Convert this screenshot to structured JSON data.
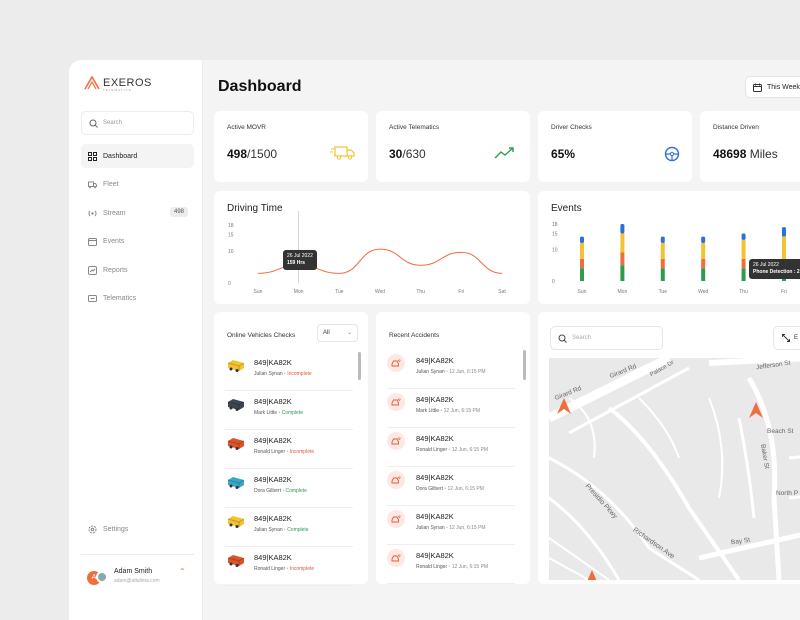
{
  "app": {
    "logo_text": "EXEROS",
    "logo_sub": "TELEMATICS"
  },
  "sidebar": {
    "search_placeholder": "Search",
    "items": [
      {
        "label": "Dashboard",
        "icon": "grid-icon",
        "active": true
      },
      {
        "label": "Fleet",
        "icon": "truck-icon"
      },
      {
        "label": "Stream",
        "icon": "stream-icon",
        "badge": "498"
      },
      {
        "label": "Events",
        "icon": "calendar-icon"
      },
      {
        "label": "Reports",
        "icon": "report-icon"
      },
      {
        "label": "Telematics",
        "icon": "telematics-icon"
      }
    ],
    "settings_label": "Settings",
    "user": {
      "name": "Adam Smith",
      "email": "adam@altalima.com",
      "initial": "A"
    }
  },
  "header": {
    "title": "Dashboard",
    "period": "This Week"
  },
  "stats": [
    {
      "label": "Active MOVR",
      "value": "498",
      "sub": "/1500",
      "icon": "truck-icon"
    },
    {
      "label": "Active Telematics",
      "value": "30",
      "sub": "/630",
      "icon": "trend-icon"
    },
    {
      "label": "Driver  Checks",
      "value": "65%",
      "sub": "",
      "icon": "steering-wheel-icon"
    },
    {
      "label": "Distance Driven",
      "value": "48698",
      "sub": " Miles",
      "icon": ""
    }
  ],
  "driving_time": {
    "title": "Driving Time",
    "tooltip": {
      "date": "26 Jul 2022",
      "value": "159 Hrs"
    }
  },
  "events": {
    "title": "Events",
    "tooltip": {
      "date": "26 Jul 2022",
      "value": "Phone Detection : 2"
    }
  },
  "chart_data": [
    {
      "type": "line",
      "title": "Driving Time",
      "categories": [
        "Sun",
        "Mon",
        "Tue",
        "Wed",
        "Thu",
        "Fri",
        "Sat"
      ],
      "y_ticks": [
        "0",
        "10",
        "15",
        "18"
      ],
      "series": [
        {
          "values": [
            3,
            5.5,
            3,
            10.5,
            5.5,
            9.5,
            3
          ]
        }
      ],
      "ylim": [
        0,
        18
      ],
      "grid": false,
      "color": "#f26d3d"
    },
    {
      "type": "bar",
      "title": "Events",
      "categories": [
        "Sun",
        "Mon",
        "Tue",
        "Wed",
        "Thu",
        "Fri"
      ],
      "y_ticks": [
        "0",
        "10",
        "15",
        "18"
      ],
      "stacked": true,
      "colors": [
        "#2e9b4f",
        "#f26d3d",
        "#f2c230",
        "#2f6fdb"
      ],
      "series": [
        {
          "values": [
            4,
            5,
            4,
            4,
            4,
            4
          ]
        },
        {
          "values": [
            3,
            4,
            3,
            3,
            3,
            3
          ]
        },
        {
          "values": [
            5,
            6,
            5,
            5,
            6,
            7
          ]
        },
        {
          "values": [
            2,
            3,
            2,
            2,
            2,
            3
          ]
        }
      ],
      "ylim": [
        0,
        18
      ]
    }
  ],
  "vehicles": {
    "title": "Online Vehicles Checks",
    "filter": "All",
    "rows": [
      {
        "plate": "849|KA82K",
        "driver": "Julian Synan",
        "status": "Incomplete",
        "color": "#f2c230"
      },
      {
        "plate": "849|KA82K",
        "driver": "Mark Little",
        "status": "Complete",
        "color": "#3d4452"
      },
      {
        "plate": "849|KA82K",
        "driver": "Ronald Linger",
        "status": "Incomplete",
        "color": "#d9542b"
      },
      {
        "plate": "849|KA82K",
        "driver": "Dora Gilbert",
        "status": "Complete",
        "color": "#3aa7c9"
      },
      {
        "plate": "849|KA82K",
        "driver": "Julian Synan",
        "status": "Complete",
        "color": "#f2c230"
      },
      {
        "plate": "849|KA82K",
        "driver": "Ronald Linger",
        "status": "Incomplete",
        "color": "#d9542b"
      }
    ]
  },
  "accidents": {
    "title": "Recent Accidents",
    "rows": [
      {
        "plate": "849|KA82K",
        "driver": "Julian Synan",
        "time": "12 Jun, 6:15 PM"
      },
      {
        "plate": "849|KA82K",
        "driver": "Mark Little",
        "time": "12 Jun, 6:15 PM"
      },
      {
        "plate": "849|KA82K",
        "driver": "Ronald Linger",
        "time": "12 Jun, 6:15 PM"
      },
      {
        "plate": "849|KA82K",
        "driver": "Dora Gilbert",
        "time": "12 Jun, 6:15 PM"
      },
      {
        "plate": "849|KA82K",
        "driver": "Julian Synan",
        "time": "12 Jun, 6:15 PM"
      },
      {
        "plate": "849|KA82K",
        "driver": "Ronald Linger",
        "time": "12 Jun, 6:15 PM"
      }
    ]
  },
  "map": {
    "search_placeholder": "Search",
    "expand_label": "E",
    "streets": [
      "Girard Rd",
      "Girard Rd",
      "Palace Dr",
      "Jefferson St",
      "Beach St",
      "Baker St",
      "North P",
      "Presidio Pkwy",
      "Richardson Ave",
      "Bay St"
    ]
  }
}
